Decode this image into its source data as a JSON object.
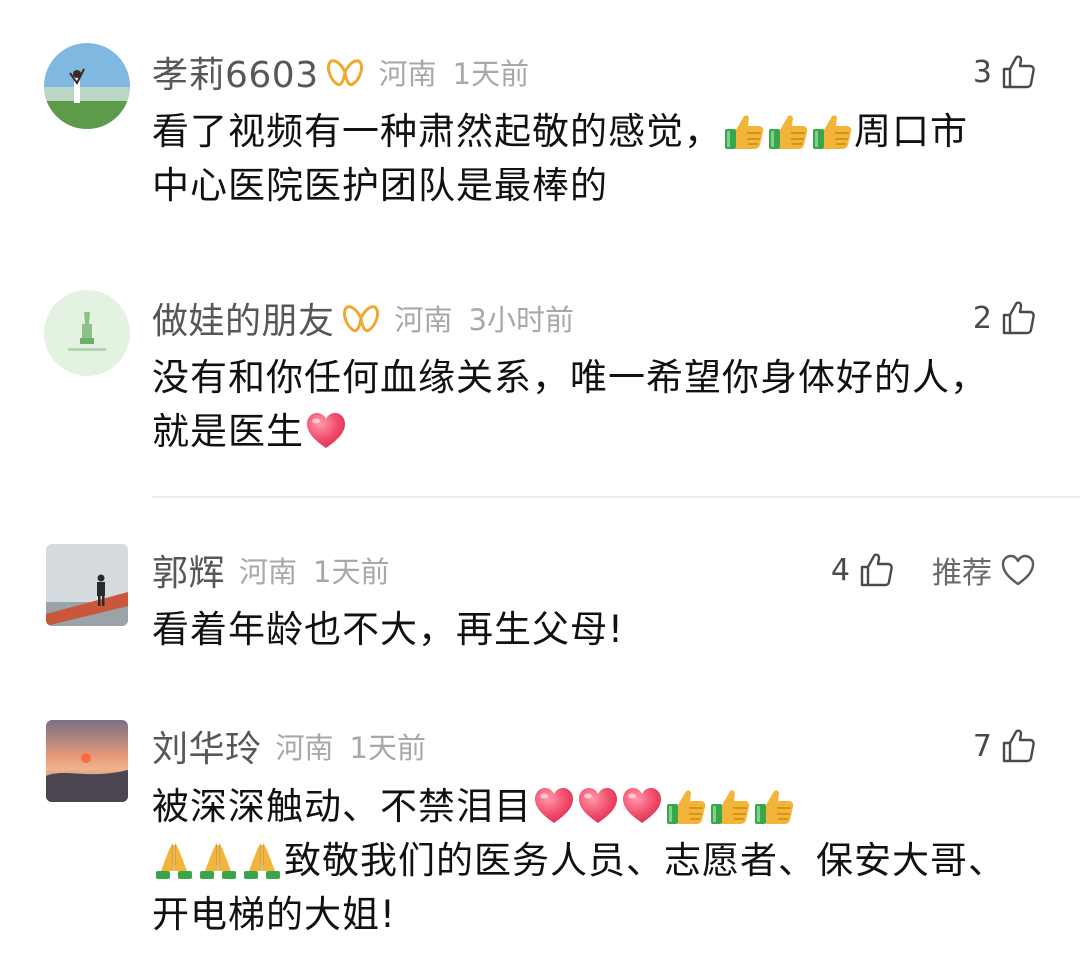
{
  "comments": [
    {
      "username": "孝莉6603",
      "region": "河南",
      "time": "1天前",
      "likes": "3",
      "has_badge": true,
      "avatar_icon": "sky-field-photo-avatar",
      "text_line1_a": "看了视频有一种肃然起敬的感觉，",
      "text_line1_emojis": [
        "thumbs-up-emoji",
        "thumbs-up-emoji",
        "thumbs-up-emoji"
      ],
      "text_line1_b": "周口市",
      "text_line2": "中心医院医护团队是最棒的"
    },
    {
      "username": "做娃的朋友",
      "region": "河南",
      "time": "3小时前",
      "likes": "2",
      "has_badge": true,
      "avatar_icon": "green-logo-avatar",
      "text_line1": "没有和你任何血缘关系，唯一希望你身体好的人，",
      "text_line2": "就是医生",
      "text_line2_emojis": [
        "heart-emoji"
      ]
    },
    {
      "username": "郭辉",
      "region": "河南",
      "time": "1天前",
      "likes": "4",
      "recommend_label": "推荐",
      "avatar_icon": "person-on-wall-photo-avatar",
      "text_line1": "看着年龄也不大，再生父母!"
    },
    {
      "username": "刘华玲",
      "region": "河南",
      "time": "1天前",
      "likes": "7",
      "avatar_icon": "sunset-photo-avatar",
      "text_line1": "被深深触动、不禁泪目",
      "text_line1_emojis": [
        "heart-emoji",
        "heart-emoji",
        "heart-emoji",
        "thumbs-up-emoji",
        "thumbs-up-emoji",
        "thumbs-up-emoji"
      ],
      "text_line2_emojis": [
        "praying-hands-emoji",
        "praying-hands-emoji",
        "praying-hands-emoji"
      ],
      "text_line2": "致敬我们的医务人员、志愿者、保安大哥、",
      "text_line3": "开电梯的大姐!"
    }
  ],
  "colors": {
    "badge": "#f0a830",
    "username": "#575757",
    "meta": "#a8a8a8",
    "text": "#111111",
    "heart": "#f24d6b",
    "thumb": "#f2b53a",
    "thumb_cuff": "#3aa64b"
  }
}
